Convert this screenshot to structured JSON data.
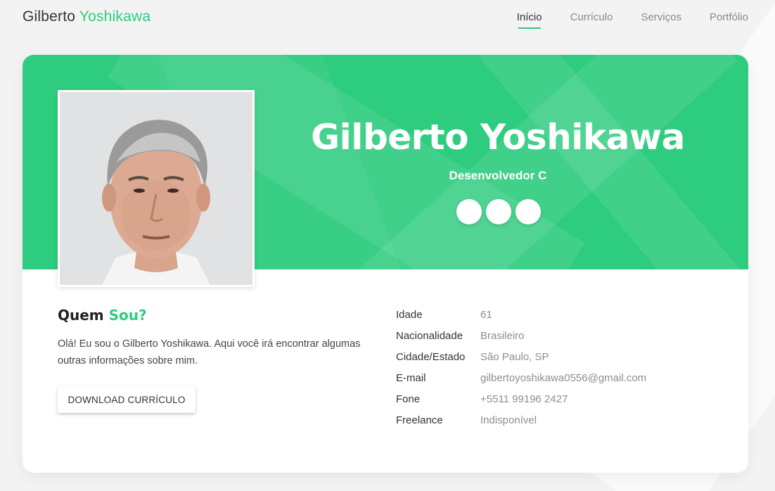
{
  "brand": {
    "first": "Gilberto",
    "second": "Yoshikawa"
  },
  "nav": [
    {
      "label": "Início",
      "active": true
    },
    {
      "label": "Currículo",
      "active": false
    },
    {
      "label": "Serviços",
      "active": false
    },
    {
      "label": "Portfólio",
      "active": false
    }
  ],
  "hero": {
    "name": "Gilberto Yoshikawa",
    "role": "Desenvolvedor C",
    "socials": [
      {
        "icon": "social-icon-1",
        "glyph": ""
      },
      {
        "icon": "social-icon-2",
        "glyph": ""
      },
      {
        "icon": "social-icon-3",
        "glyph": ""
      }
    ]
  },
  "about": {
    "title_prefix": "Quem",
    "title_accent": "Sou?",
    "text": "Olá! Eu sou o Gilberto Yoshikawa. Aqui você irá encontrar algumas outras informações sobre mim.",
    "download_label": "DOWNLOAD CURRÍCULO"
  },
  "info": [
    {
      "label": "Idade",
      "value": "61"
    },
    {
      "label": "Nacionalidade",
      "value": "Brasileiro"
    },
    {
      "label": "Cidade/Estado",
      "value": "São Paulo, SP"
    },
    {
      "label": "E-mail",
      "value": "gilbertoyoshikawa0556@gmail.com"
    },
    {
      "label": "Fone",
      "value": "+5511 99196 2427"
    },
    {
      "label": "Freelance",
      "value": "Indisponível"
    }
  ],
  "colors": {
    "accent": "#2ecc7e",
    "text": "#333333",
    "muted": "#8e8e8e"
  }
}
